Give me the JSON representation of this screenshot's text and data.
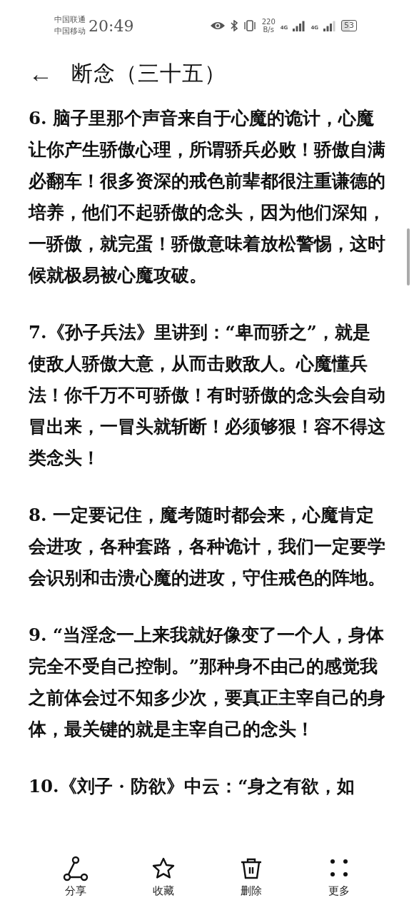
{
  "status_bar": {
    "carriers": [
      "中国联通",
      "中国移动"
    ],
    "time": "20:49",
    "net_speed": [
      "220",
      "B/s"
    ],
    "signal_labels": [
      "4G",
      "4G"
    ],
    "battery": "53"
  },
  "header": {
    "back": "←",
    "title": "断念（三十五）"
  },
  "paragraphs": [
    "6. 脑子里那个声音来自于心魔的诡计，心魔让你产生骄傲心理，所谓骄兵必败！骄傲自满必翻车！很多资深的戒色前辈都很注重谦德的培养，他们不起骄傲的念头，因为他们深知，一骄傲，就完蛋！骄傲意味着放松警惕，这时候就极易被心魔攻破。",
    "7.《孙子兵法》里讲到：“卑而骄之”，就是使敌人骄傲大意，从而击败敌人。心魔懂兵法！你千万不可骄傲！有时骄傲的念头会自动冒出来，一冒头就斩断！必须够狠！容不得这类念头！",
    "8. 一定要记住，魔考随时都会来，心魔肯定会进攻，各种套路，各种诡计，我们一定要学会识别和击溃心魔的进攻，守住戒色的阵地。",
    "9. “当淫念一上来我就好像变了一个人，身体完全不受自己控制。”那种身不由己的感觉我之前体会过不知多少次，要真正主宰自己的身体，最关键的就是主宰自己的念头！",
    "10.《刘子 · 防欲》中云：“身之有欲，如"
  ],
  "toolbar": [
    {
      "kind": "share",
      "label": "分享"
    },
    {
      "kind": "star",
      "label": "收藏"
    },
    {
      "kind": "trash",
      "label": "删除"
    },
    {
      "kind": "more",
      "label": "更多"
    }
  ]
}
